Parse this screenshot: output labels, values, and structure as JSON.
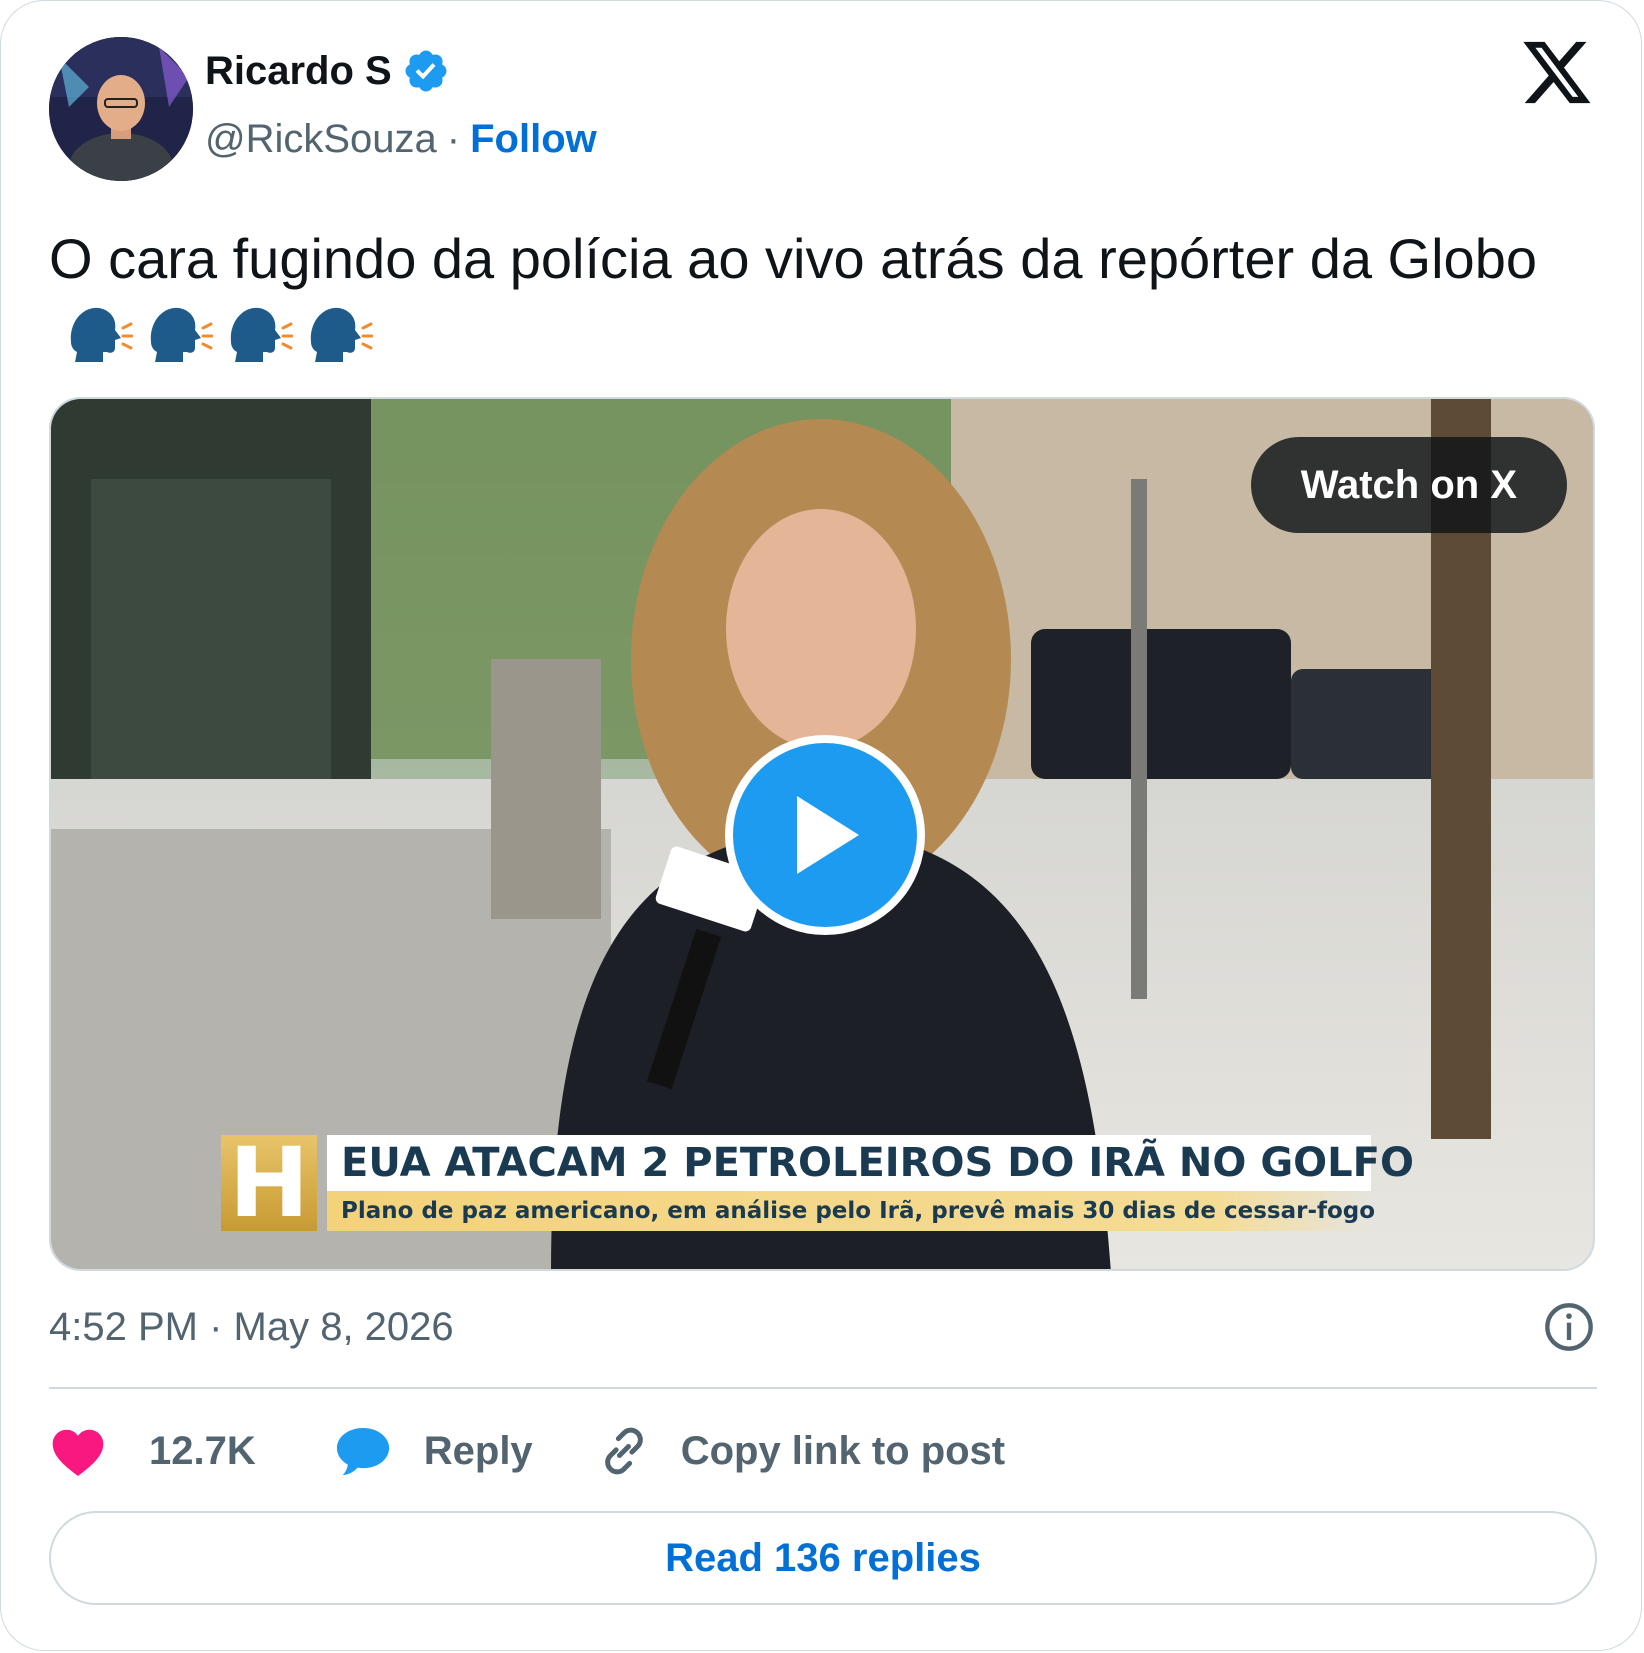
{
  "author": {
    "name": "Ricardo S",
    "handle": "@RickSouza",
    "verified": true,
    "follow_label": "Follow",
    "separator": "·"
  },
  "platform_icon": "x-logo-icon",
  "tweet": {
    "text": "O cara fugindo da polícia ao vivo atrás da repórter da Globo",
    "emojis": [
      "speaking-head-icon",
      "speaking-head-icon",
      "speaking-head-icon",
      "speaking-head-icon"
    ]
  },
  "media": {
    "watch_label": "Watch on X",
    "lower_third": {
      "badge": "H",
      "headline": "EUA ATACAM 2 PETROLEIROS DO IRÃ NO GOLFO",
      "subline": "Plano de paz americano, em análise pelo Irã, prevê mais 30 dias de cessar-fogo"
    }
  },
  "meta": {
    "timestamp": "4:52 PM · May 8, 2026"
  },
  "actions": {
    "likes": "12.7K",
    "reply_label": "Reply",
    "copy_link_label": "Copy link to post"
  },
  "read_replies_label": "Read 136 replies",
  "colors": {
    "link_blue": "#006fd6",
    "like_pink": "#f91880",
    "reply_blue": "#1d9bf0",
    "secondary_text": "#536471",
    "border": "#cfd9de"
  }
}
